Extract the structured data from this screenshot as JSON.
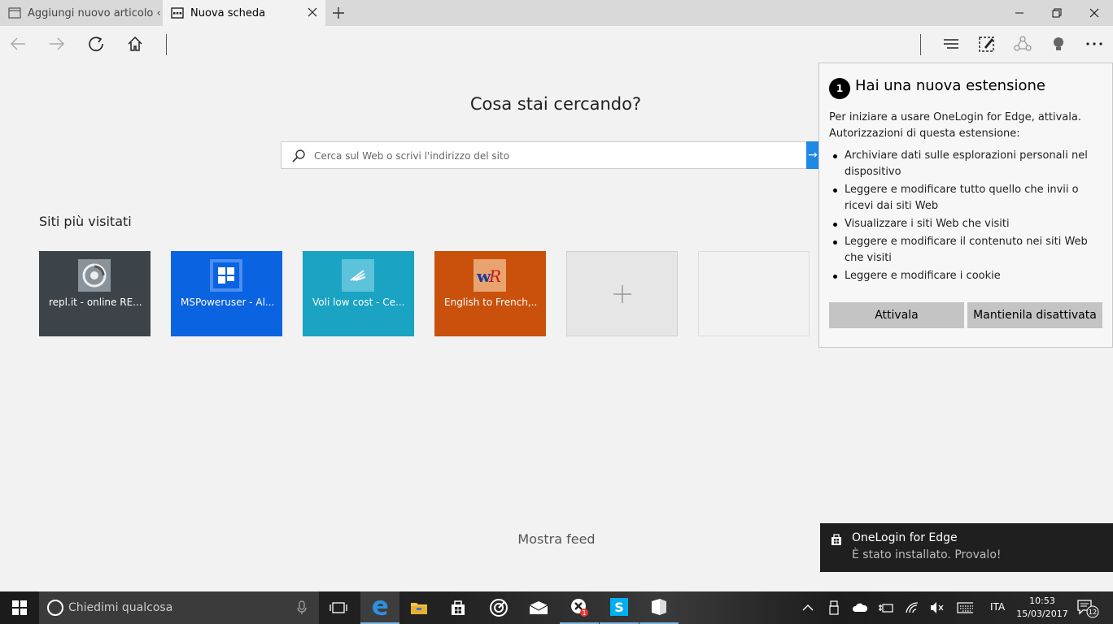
{
  "tabs": [
    {
      "label": "Aggiungi nuovo articolo ‹ W",
      "active": false
    },
    {
      "label": "Nuova scheda",
      "active": true
    }
  ],
  "main": {
    "search_heading": "Cosa stai cercando?",
    "search_placeholder": "Cerca sul Web o scrivi l'indirizzo del sito",
    "search_go": "→",
    "top_sites_title": "Siti più visitati",
    "tiles": [
      {
        "label": "repl.it - online RE...",
        "color": "#3d4449"
      },
      {
        "label": "MSPoweruser - Al...",
        "color": "#0a63e0"
      },
      {
        "label": "Voli low cost - Ce...",
        "color": "#1aa3c3"
      },
      {
        "label": "English to French,...",
        "color": "#c9510c"
      }
    ],
    "show_feed": "Mostra feed"
  },
  "extension_popup": {
    "badge": "1",
    "title": "Hai una nuova estensione",
    "intro": "Per iniziare a usare OneLogin for Edge, attivala. Autorizzazioni di questa estensione:",
    "permissions": [
      "Archiviare dati sulle esplorazioni personali nel dispositivo",
      "Leggere e modificare tutto quello che invii o ricevi dai siti Web",
      "Visualizzare i siti Web che visiti",
      "Leggere e modificare il contenuto nei siti Web che visiti",
      "Leggere e modificare i cookie"
    ],
    "activate_label": "Attivala",
    "keep_off_label": "Mantienila disattivata"
  },
  "toast": {
    "title": "OneLogin for Edge",
    "body": "È stato installato. Provalo!"
  },
  "taskbar": {
    "search_placeholder": "Chiedimi qualcosa",
    "badge_count": "1",
    "language": "ITA",
    "time": "10:53",
    "date": "15/03/2017",
    "notification_count": "12"
  },
  "colors": {
    "accent": "#1e88e5",
    "tabbar": "#d9d9d9",
    "page_bg": "#f2f2f2"
  }
}
